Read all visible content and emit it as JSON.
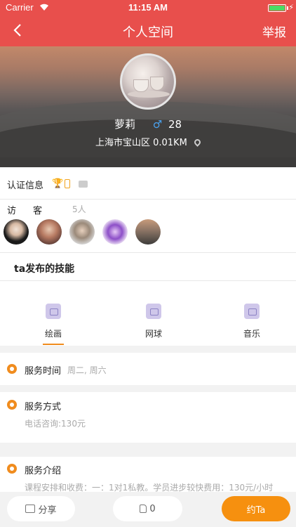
{
  "status_bar": {
    "carrier": "Carrier",
    "time": "11:15 AM"
  },
  "nav": {
    "title": "个人空间",
    "report": "举报"
  },
  "profile": {
    "name": "萝莉",
    "gender_symbol": "♂",
    "age": "28",
    "location": "上海市宝山区 0.01KM"
  },
  "certification": {
    "label": "认证信息"
  },
  "visitors": {
    "label": "访客",
    "count": "5人"
  },
  "skills": {
    "title": "ta发布的技能",
    "items": [
      "绘画",
      "网球",
      "音乐"
    ]
  },
  "service_time": {
    "label": "服务时间",
    "value": "周二, 周六"
  },
  "service_method": {
    "label": "服务方式",
    "value": "电话咨询:130元"
  },
  "service_intro": {
    "label": "服务介绍",
    "value": "课程安排和收费：一：1对1私教。学员进步较快费用：130元/小时"
  },
  "bottom_bar": {
    "share": "分享",
    "likes": "0",
    "contact": "约Ta"
  },
  "colors": {
    "nav_bg": "#e84f4c",
    "accent": "#f6900f",
    "male": "#4aa3f0"
  }
}
